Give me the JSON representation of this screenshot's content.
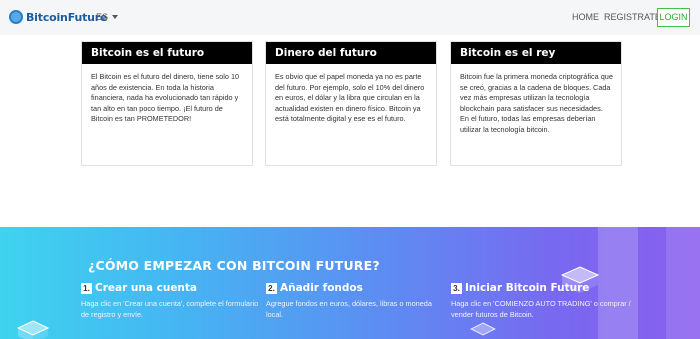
{
  "header": {
    "logo_text": "BitcoinFuture",
    "language": "ES",
    "nav_home": "HOME",
    "nav_register": "REGISTRATE",
    "nav_login": "LOGIN"
  },
  "cards": [
    {
      "title": "Bitcoin es el futuro",
      "body": "El Bitcoin es el futuro del dinero, tiene solo 10 años de existencia. En toda la historia financiera, nada ha evolucionado tan rápido y tan alto en tan poco tiempo. ¡El futuro de Bitcoin es tan PROMETEDOR!"
    },
    {
      "title": "Dinero del futuro",
      "body": "Es obvio que el papel moneda ya no es parte del futuro. Por ejemplo, solo el 10% del dinero en euros, el dólar y la libra que circulan en la actualidad existen en dinero físico. Bitcoin ya está totalmente digital y ese es el futuro."
    },
    {
      "title": "Bitcoin es el rey",
      "body": "Bitcoin fue la primera moneda criptográfica que se creó, gracias a la cadena de bloques. Cada vez más empresas utilizan la tecnología blockchain para satisfacer sus necesidades. En el futuro, todas las empresas deberían utilizar la tecnología bitcoin."
    }
  ],
  "howto": {
    "title": "¿CÓMO EMPEZAR CON BITCOIN FUTURE?",
    "steps": [
      {
        "num": "1.",
        "title": "Crear una cuenta",
        "desc": "Haga clic en 'Crear una cuenta', complete el formulario de registro y envíe."
      },
      {
        "num": "2.",
        "title": "Añadir fondos",
        "desc": "Agregue fondos en euros, dólares, libras o moneda local."
      },
      {
        "num": "3.",
        "title": "Iniciar Bitcoin Future",
        "desc": "Haga clic en 'COMIENZO AUTO TRADING' o comprar / vender futuros de Bitcoin."
      }
    ]
  }
}
